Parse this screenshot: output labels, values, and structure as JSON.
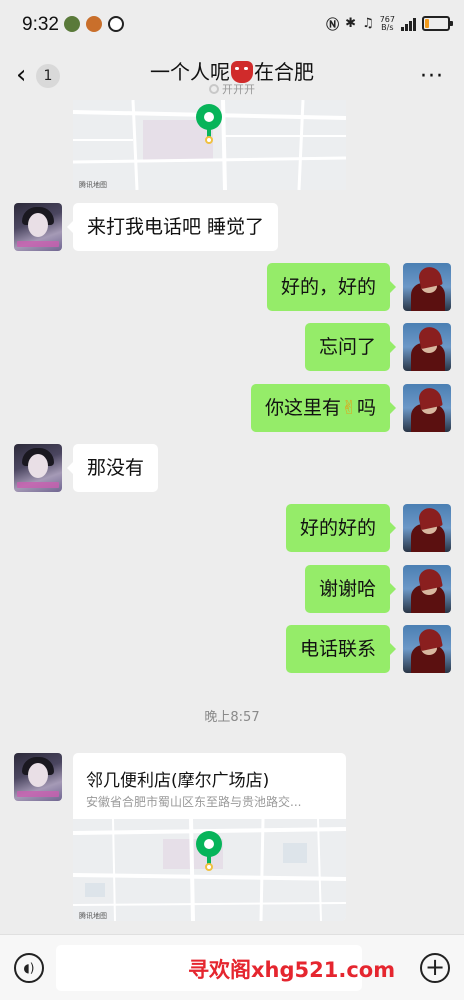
{
  "status_bar": {
    "time": "9:32",
    "network_speed_value": "767",
    "network_speed_unit": "B/s",
    "battery_level": 0.2,
    "battery_color": "#f29b1c"
  },
  "chat": {
    "back_icon": "chevron-left-icon",
    "unread_count": "1",
    "title_before": "一个人呢",
    "title_after": "在合肥",
    "title_emoji": "red-mask-emoji",
    "subtitle": "开开开",
    "more_icon": "more-dots-icon"
  },
  "messages": {
    "m1": "来打我电话吧 睡觉了",
    "m2": "好的，好的",
    "m3": "忘问了",
    "m4_before": "你这里有",
    "m4_emoji": "✌",
    "m4_after": "吗",
    "m5": "那没有",
    "m6": "好的好的",
    "m7": "谢谢哈",
    "m8": "电话联系"
  },
  "timestamp": "晚上8:57",
  "location": {
    "name": "邻几便利店(摩尔广场店)",
    "address": "安徽省合肥市蜀山区东至路与贵池路交...",
    "map_watermark": "腾讯地图"
  },
  "top_map": {
    "map_watermark": "腾讯地图"
  },
  "input_bar": {
    "voice_icon": "voice-icon",
    "placeholder": "",
    "plus_icon": "plus-icon"
  },
  "watermark": "寻欢阁xhg521.com",
  "colors": {
    "outgoing_bubble": "#95ec69",
    "incoming_bubble": "#ffffff",
    "background": "#ededed",
    "map_pin": "#07b45a"
  }
}
